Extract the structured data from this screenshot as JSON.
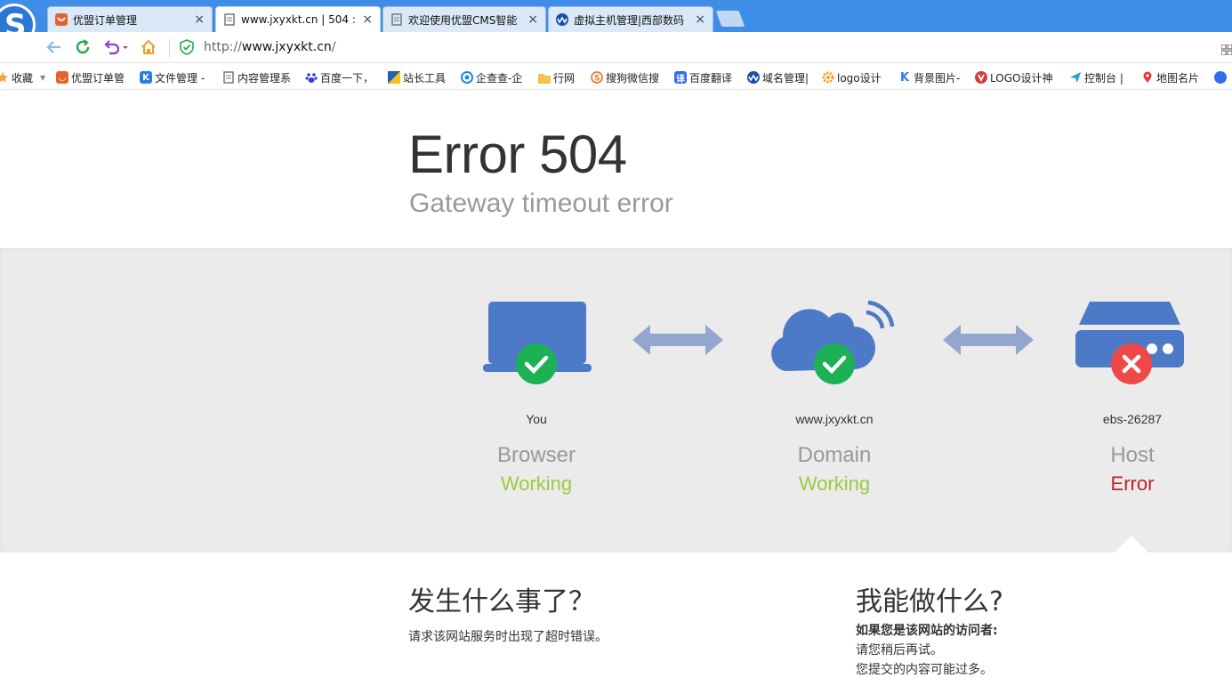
{
  "browser": {
    "tabs": [
      {
        "label": "优盟订单管理",
        "close": "×"
      },
      {
        "label": "www.jxyxkt.cn | 504 : G",
        "close": "×"
      },
      {
        "label": "欢迎使用优盟CMS智能",
        "close": "×"
      },
      {
        "label": "虚拟主机管理|西部数码",
        "close": "×"
      }
    ],
    "url_prefix": "http://",
    "url_host": "www.jxyxkt.cn",
    "url_suffix": "/",
    "bookmarks": [
      {
        "label": "收藏",
        "icon": "star-icon",
        "color": "#f2a33a"
      },
      {
        "label": "优盟订单管",
        "icon": "youmeng-icon",
        "color": "#e8622c"
      },
      {
        "label": "文件管理 -",
        "icon": "k-icon",
        "color": "#2d7de0"
      },
      {
        "label": "内容管理系",
        "icon": "page-icon",
        "color": "#777777"
      },
      {
        "label": "百度一下，",
        "icon": "baidu-paw-icon",
        "color": "#2f3fd8"
      },
      {
        "label": "站长工具",
        "icon": "chinaz-icon",
        "color": "#e8b400"
      },
      {
        "label": "企查查-企",
        "icon": "qichacha-icon",
        "color": "#1e88e5"
      },
      {
        "label": "行网",
        "icon": "folder-icon",
        "color": "#f3c34a"
      },
      {
        "label": "搜狗微信搜",
        "icon": "sogou-icon",
        "color": "#f07a2b"
      },
      {
        "label": "百度翻译",
        "icon": "translate-icon",
        "color": "#2f6ee8"
      },
      {
        "label": "域名管理|",
        "icon": "west-icon",
        "color": "#1b4fa8"
      },
      {
        "label": "logo设计",
        "icon": "gear-icon",
        "color": "#f2a020"
      },
      {
        "label": "背景图片-",
        "icon": "k-icon",
        "color": "#2d7de0"
      },
      {
        "label": "LOGO设计神",
        "icon": "logo-icon",
        "color": "#d93b3b"
      },
      {
        "label": "控制台 |",
        "icon": "send-icon",
        "color": "#2a9be0"
      },
      {
        "label": "地图名片",
        "icon": "map-pin-icon",
        "color": "#e23a3a"
      }
    ]
  },
  "error": {
    "title": "Error 504",
    "subtitle": "Gateway timeout error"
  },
  "nodes": [
    {
      "label": "You",
      "title": "Browser",
      "status": "Working",
      "state": "ok",
      "icon": "laptop-icon"
    },
    {
      "label": "www.jxyxkt.cn",
      "title": "Domain",
      "status": "Working",
      "state": "ok",
      "icon": "cloud-icon"
    },
    {
      "label": "ebs-26287",
      "title": "Host",
      "status": "Error",
      "state": "error",
      "icon": "server-icon"
    }
  ],
  "colors": {
    "icon_blue": "#4d7ac6",
    "arrow_blue": "#93a6cf",
    "ok_green": "#9bca3e",
    "check_green": "#1bb154",
    "error_red": "#bd2426",
    "x_red": "#f04848"
  },
  "what_happened": {
    "title": "发生什么事了？",
    "text": "请求该网站服务时出现了超时错误。"
  },
  "what_can_i_do": {
    "title": "我能做什么?",
    "heading": "如果您是该网站的访问者:",
    "line1": "请您稍后再试。",
    "line2": "您提交的内容可能过多。"
  }
}
